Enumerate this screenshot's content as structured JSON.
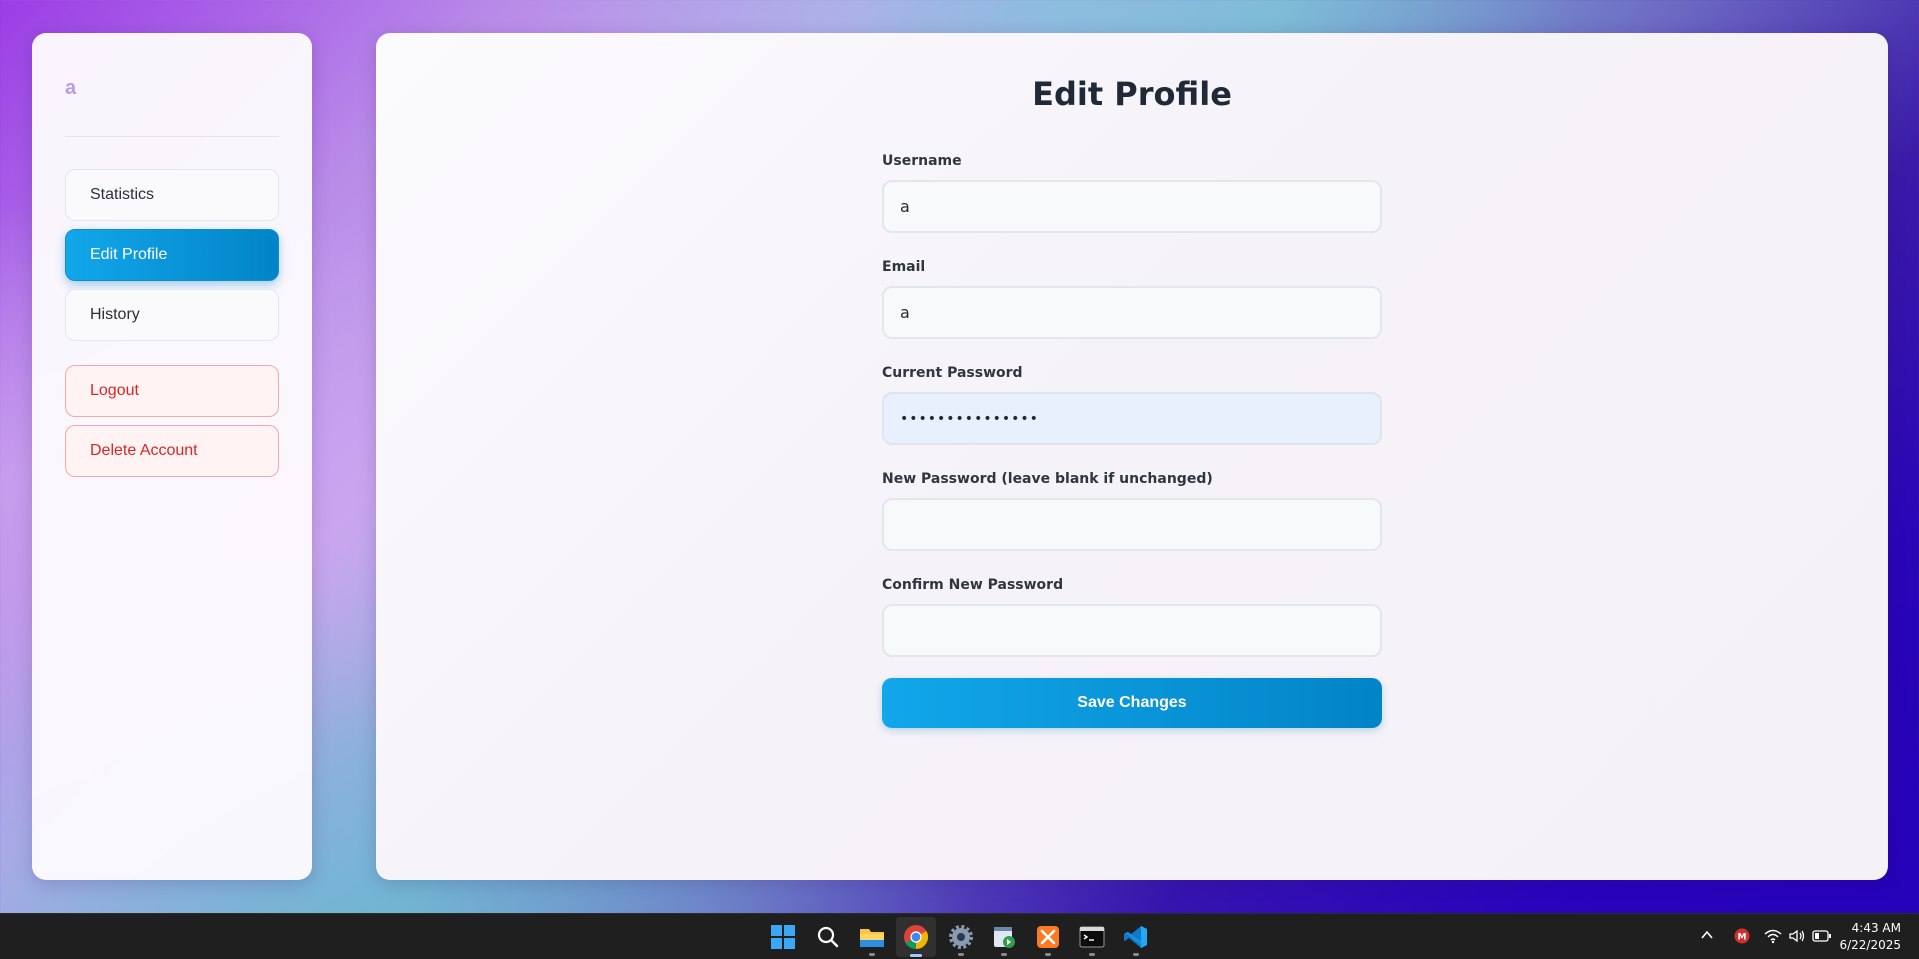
{
  "sidebar": {
    "brand": "a",
    "nav": [
      {
        "label": "Statistics"
      },
      {
        "label": "Edit Profile"
      },
      {
        "label": "History"
      }
    ],
    "actions": [
      {
        "label": "Logout"
      },
      {
        "label": "Delete Account"
      }
    ]
  },
  "main": {
    "title": "Edit Profile",
    "fields": {
      "username": {
        "label": "Username",
        "value": "a"
      },
      "email": {
        "label": "Email",
        "value": "a"
      },
      "current_password": {
        "label": "Current Password",
        "value": "•••••••••••••••"
      },
      "new_password": {
        "label": "New Password (leave blank if unchanged)",
        "value": ""
      },
      "confirm_password": {
        "label": "Confirm New Password",
        "value": ""
      }
    },
    "save_label": "Save Changes"
  },
  "taskbar": {
    "apps": [
      "start-icon",
      "search-icon",
      "file-explorer-icon",
      "chrome-icon",
      "settings-icon",
      "task-manager-icon",
      "xampp-icon",
      "terminal-icon",
      "vscode-icon"
    ],
    "tray": {
      "time": "4:43 AM",
      "date": "6/22/2025"
    }
  },
  "colors": {
    "accent": "#0ea5e9",
    "accent_dark": "#0284c7",
    "danger": "#dc2626",
    "brand": "#b99be6"
  }
}
